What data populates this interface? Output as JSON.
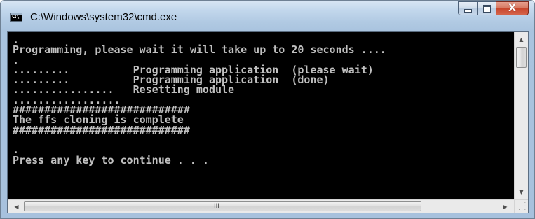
{
  "window": {
    "title": "C:\\Windows\\system32\\cmd.exe",
    "icon_label": "C:\\",
    "icon": "cmd-console-icon",
    "close_glyph": "X"
  },
  "console": {
    "text": ".\nProgramming, please wait it will take up to 20 seconds ....\n.\n.........          Programming application  (please wait)\n.........          Programming application  (done)\n................   Resetting module\n.................\n############################\nThe ffs cloning is complete\n############################\n\n.\nPress any key to continue . . .",
    "foreground": "#c0c0c0",
    "background": "#000000"
  },
  "scrollbars": {
    "up_arrow": "▲",
    "down_arrow": "▼",
    "left_arrow": "◀",
    "right_arrow": "▶",
    "grip": "III"
  },
  "colors": {
    "close_button": "#c8452b",
    "frame": "#a9c4df"
  }
}
